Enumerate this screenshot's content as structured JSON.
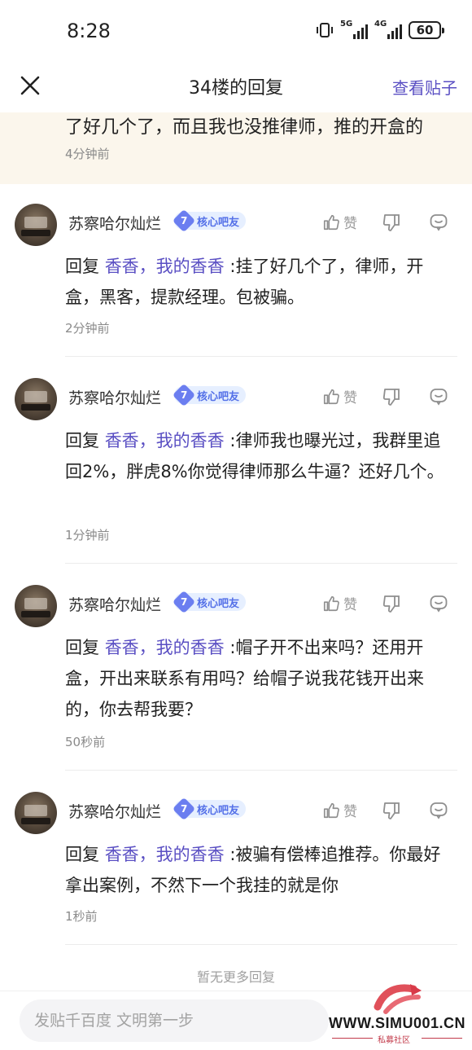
{
  "status_bar": {
    "time": "8:28",
    "network_1": "5G",
    "network_2": "4G",
    "battery": "60"
  },
  "header": {
    "title": "34楼的回复",
    "view_post": "查看贴子"
  },
  "origin": {
    "text": "了好几个了，而且我也没推律师，推的开盒的",
    "time": "4分钟前"
  },
  "replies": [
    {
      "username": "苏察哈尔灿烂",
      "level": "7",
      "badge": "核心吧友",
      "like_label": "赞",
      "prefix": "回复 ",
      "target": "香香，我的香香",
      "text": " :挂了好几个了，律师，开盒，黑客，提款经理。包被骗。",
      "time": "2分钟前"
    },
    {
      "username": "苏察哈尔灿烂",
      "level": "7",
      "badge": "核心吧友",
      "like_label": "赞",
      "prefix": "回复 ",
      "target": "香香，我的香香",
      "text": " :律师我也曝光过，我群里追回2%，胖虎8%你觉得律师那么牛逼？还好几个。",
      "time": "1分钟前"
    },
    {
      "username": "苏察哈尔灿烂",
      "level": "7",
      "badge": "核心吧友",
      "like_label": "赞",
      "prefix": "回复 ",
      "target": "香香，我的香香",
      "text": " :帽子开不出来吗？还用开盒，开出来联系有用吗？给帽子说我花钱开出来的，你去帮我要？",
      "time": "50秒前"
    },
    {
      "username": "苏察哈尔灿烂",
      "level": "7",
      "badge": "核心吧友",
      "like_label": "赞",
      "prefix": "回复 ",
      "target": "香香，我的香香",
      "text": " :被骗有偿棒追推荐。你最好拿出案例，不然下一个我挂的就是你",
      "time": "1秒前"
    }
  ],
  "no_more": "暂无更多回复",
  "bottom": {
    "placeholder": "发贴千百度 文明第一步"
  },
  "watermark": {
    "url": "WWW.SIMU001.CN",
    "sub": "私募社区"
  },
  "colors": {
    "accent": "#5a4fc3",
    "origin_bg": "#fbf6ec",
    "badge_bg": "#e6efff"
  }
}
